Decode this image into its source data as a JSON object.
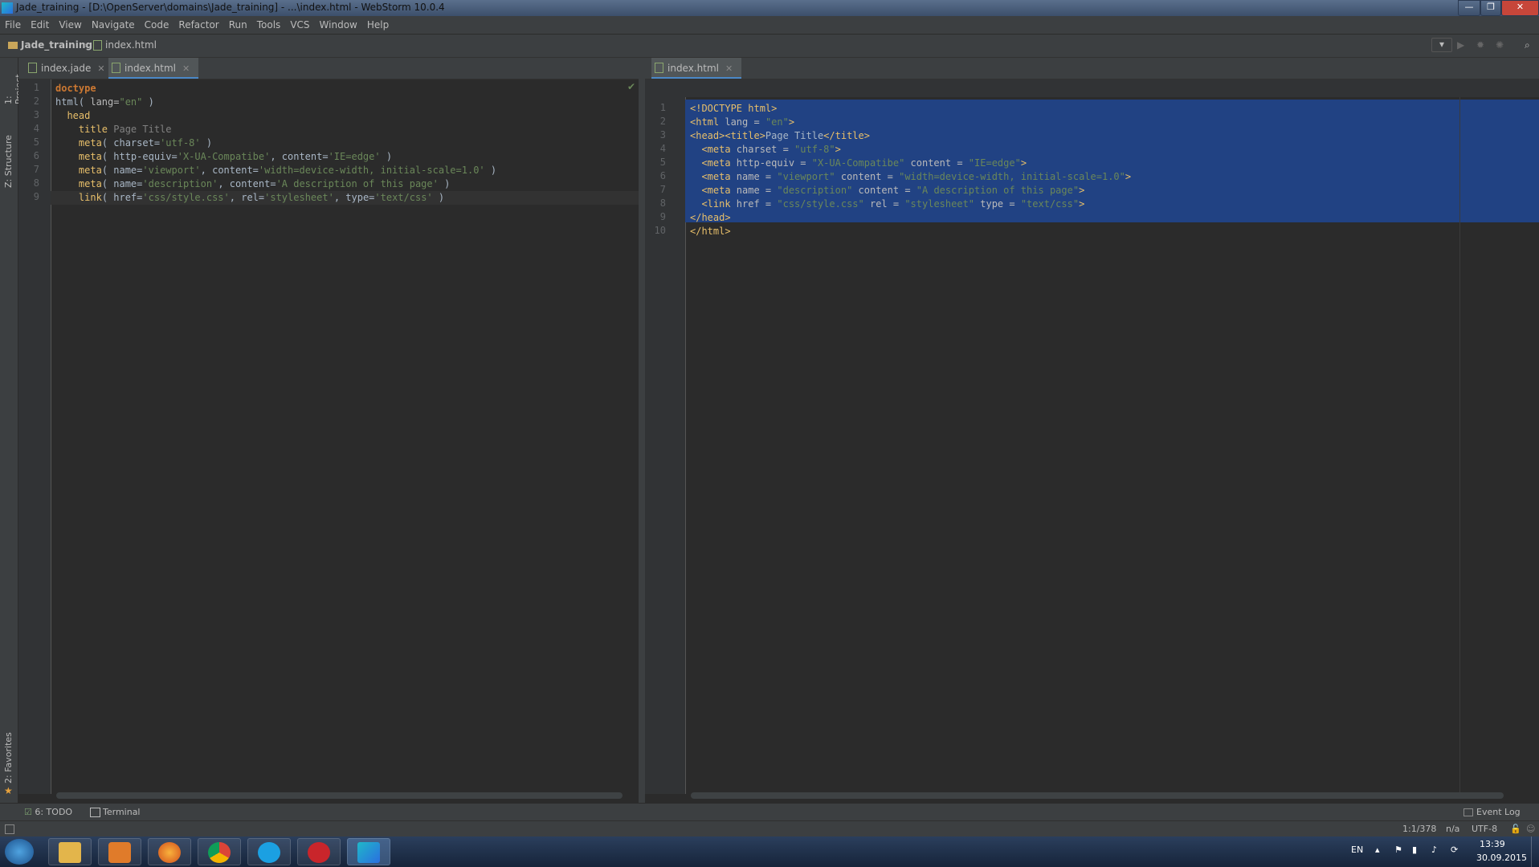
{
  "window": {
    "title": "Jade_training - [D:\\OpenServer\\domains\\Jade_training] - ...\\index.html - WebStorm 10.0.4"
  },
  "menu": [
    "File",
    "Edit",
    "View",
    "Navigate",
    "Code",
    "Refactor",
    "Run",
    "Tools",
    "VCS",
    "Window",
    "Help"
  ],
  "breadcrumb": {
    "project": "Jade_training",
    "file": "index.html"
  },
  "left_strip": {
    "project": "1: Project",
    "structure": "Z: Structure",
    "favorites": "2: Favorites"
  },
  "left_pane": {
    "tabs": [
      {
        "label": "index.jade"
      },
      {
        "label": "index.html"
      }
    ],
    "line_numbers": [
      "1",
      "2",
      "3",
      "4",
      "5",
      "6",
      "7",
      "8",
      "9"
    ],
    "lines": [
      [
        {
          "c": "kw",
          "t": "doctype"
        }
      ],
      [
        {
          "c": "plain",
          "t": "html( "
        },
        {
          "c": "attr",
          "t": "lang="
        },
        {
          "c": "str",
          "t": "\"en\""
        },
        {
          "c": "plain",
          "t": " )"
        }
      ],
      [
        {
          "c": "plain",
          "t": "  "
        },
        {
          "c": "tag",
          "t": "head"
        }
      ],
      [
        {
          "c": "plain",
          "t": "    "
        },
        {
          "c": "tag",
          "t": "title"
        },
        {
          "c": "txt",
          "t": " Page Title"
        }
      ],
      [
        {
          "c": "plain",
          "t": "    "
        },
        {
          "c": "tag",
          "t": "meta"
        },
        {
          "c": "plain",
          "t": "( charset="
        },
        {
          "c": "str",
          "t": "'utf-8'"
        },
        {
          "c": "plain",
          "t": " )"
        }
      ],
      [
        {
          "c": "plain",
          "t": "    "
        },
        {
          "c": "tag",
          "t": "meta"
        },
        {
          "c": "plain",
          "t": "( http-equiv="
        },
        {
          "c": "str",
          "t": "'X-UA-Compatibe'"
        },
        {
          "c": "plain",
          "t": ", content="
        },
        {
          "c": "str",
          "t": "'IE=edge'"
        },
        {
          "c": "plain",
          "t": " )"
        }
      ],
      [
        {
          "c": "plain",
          "t": "    "
        },
        {
          "c": "tag",
          "t": "meta"
        },
        {
          "c": "plain",
          "t": "( name="
        },
        {
          "c": "str",
          "t": "'viewport'"
        },
        {
          "c": "plain",
          "t": ", content="
        },
        {
          "c": "str",
          "t": "'width=device-width, initial-scale=1.0'"
        },
        {
          "c": "plain",
          "t": " )"
        }
      ],
      [
        {
          "c": "plain",
          "t": "    "
        },
        {
          "c": "tag",
          "t": "meta"
        },
        {
          "c": "plain",
          "t": "( name="
        },
        {
          "c": "str",
          "t": "'description'"
        },
        {
          "c": "plain",
          "t": ", content="
        },
        {
          "c": "str",
          "t": "'A description of this page'"
        },
        {
          "c": "plain",
          "t": " )"
        }
      ],
      [
        {
          "c": "plain",
          "t": "    "
        },
        {
          "c": "tag",
          "t": "link"
        },
        {
          "c": "plain",
          "t": "( href="
        },
        {
          "c": "str",
          "t": "'css/style.css'"
        },
        {
          "c": "plain",
          "t": ", rel="
        },
        {
          "c": "str",
          "t": "'stylesheet'"
        },
        {
          "c": "plain",
          "t": ", type="
        },
        {
          "c": "str",
          "t": "'text/css'"
        },
        {
          "c": "plain",
          "t": " )"
        }
      ]
    ]
  },
  "right_pane": {
    "tabs": [
      {
        "label": "index.html"
      }
    ],
    "line_numbers": [
      "1",
      "2",
      "3",
      "4",
      "5",
      "6",
      "7",
      "8",
      "9",
      "10"
    ],
    "lines": [
      [
        {
          "c": "tag",
          "t": "<!DOCTYPE html>"
        }
      ],
      [
        {
          "c": "tag",
          "t": "<html "
        },
        {
          "c": "attr",
          "t": "lang = "
        },
        {
          "c": "str",
          "t": "\"en\""
        },
        {
          "c": "tag",
          "t": ">"
        }
      ],
      [
        {
          "c": "tag",
          "t": "<head><title>"
        },
        {
          "c": "plain",
          "t": "Page Title"
        },
        {
          "c": "tag",
          "t": "</title>"
        }
      ],
      [
        {
          "c": "tag",
          "t": "  <meta "
        },
        {
          "c": "attr",
          "t": "charset = "
        },
        {
          "c": "str",
          "t": "\"utf-8\""
        },
        {
          "c": "tag",
          "t": ">"
        }
      ],
      [
        {
          "c": "tag",
          "t": "  <meta "
        },
        {
          "c": "attr",
          "t": "http-equiv = "
        },
        {
          "c": "str",
          "t": "\"X-UA-Compatibe\""
        },
        {
          "c": "attr",
          "t": " content = "
        },
        {
          "c": "str",
          "t": "\"IE=edge\""
        },
        {
          "c": "tag",
          "t": ">"
        }
      ],
      [
        {
          "c": "tag",
          "t": "  <meta "
        },
        {
          "c": "attr",
          "t": "name = "
        },
        {
          "c": "str",
          "t": "\"viewport\""
        },
        {
          "c": "attr",
          "t": " content = "
        },
        {
          "c": "str",
          "t": "\"width=device-width, initial-scale=1.0\""
        },
        {
          "c": "tag",
          "t": ">"
        }
      ],
      [
        {
          "c": "tag",
          "t": "  <meta "
        },
        {
          "c": "attr",
          "t": "name = "
        },
        {
          "c": "str",
          "t": "\"description\""
        },
        {
          "c": "attr",
          "t": " content = "
        },
        {
          "c": "str",
          "t": "\"A description of this page\""
        },
        {
          "c": "tag",
          "t": ">"
        }
      ],
      [
        {
          "c": "tag",
          "t": "  <link "
        },
        {
          "c": "attr",
          "t": "href = "
        },
        {
          "c": "str",
          "t": "\"css/style.css\""
        },
        {
          "c": "attr",
          "t": " rel = "
        },
        {
          "c": "str",
          "t": "\"stylesheet\""
        },
        {
          "c": "attr",
          "t": " type = "
        },
        {
          "c": "str",
          "t": "\"text/css\""
        },
        {
          "c": "tag",
          "t": ">"
        }
      ],
      [
        {
          "c": "tag",
          "t": "</head>"
        }
      ],
      [
        {
          "c": "tag",
          "t": "</html>"
        }
      ]
    ]
  },
  "bottom_tools": {
    "todo": "6: TODO",
    "terminal": "Terminal",
    "event_log": "Event Log"
  },
  "status": {
    "position": "1:1/378",
    "na": "n/a",
    "encoding": "UTF-8"
  },
  "taskbar": {
    "lang": "EN",
    "time": "13:39",
    "date": "30.09.2015"
  }
}
